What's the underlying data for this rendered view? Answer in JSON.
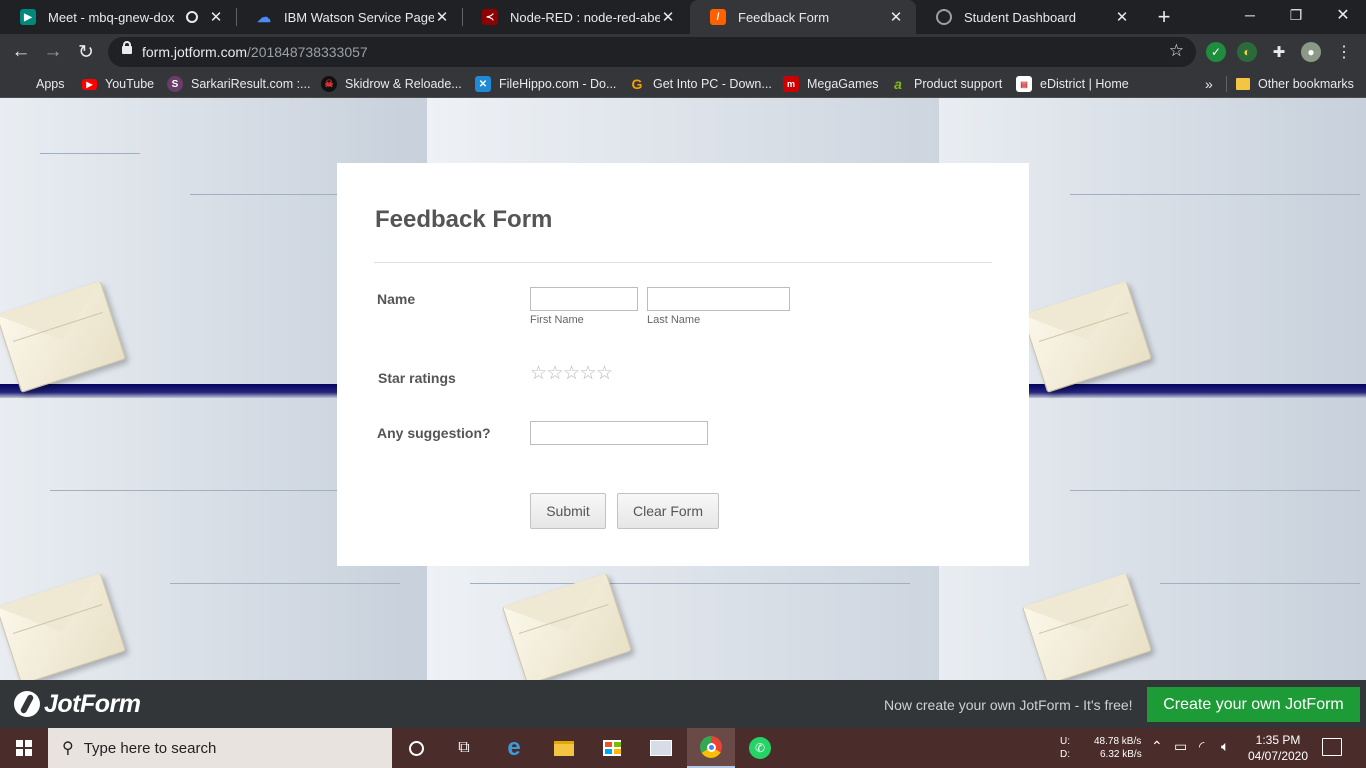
{
  "browser": {
    "tabs": [
      {
        "title": "Meet - mbq-gnew-dox",
        "active": false,
        "favicon": "google-meet-icon",
        "color": "#00897b"
      },
      {
        "title": "IBM Watson Service Page",
        "active": false,
        "favicon": "ibm-cloud-icon",
        "color": "#4a8bf5"
      },
      {
        "title": "Node-RED : node-red-abes.eu",
        "active": false,
        "favicon": "node-red-icon",
        "color": "#8f0000"
      },
      {
        "title": "Feedback Form",
        "active": true,
        "favicon": "jotform-icon",
        "color": "#ff6100"
      },
      {
        "title": "Student Dashboard",
        "active": false,
        "favicon": "globe-icon",
        "color": "#9aa0a6"
      }
    ],
    "url_domain": "form.jotform.com",
    "url_path": "/201848738333057",
    "bookmarks": [
      {
        "label": "Apps",
        "icon": "apps-grid-icon"
      },
      {
        "label": "YouTube",
        "icon": "youtube-icon"
      },
      {
        "label": "SarkariResult.com :...",
        "icon": "sarkari-result-icon"
      },
      {
        "label": "Skidrow & Reloade...",
        "icon": "skidrow-icon"
      },
      {
        "label": "FileHippo.com - Do...",
        "icon": "filehippo-icon"
      },
      {
        "label": "Get Into PC - Down...",
        "icon": "getintopc-icon"
      },
      {
        "label": "MegaGames",
        "icon": "megagames-icon"
      },
      {
        "label": "Product support",
        "icon": "acer-icon"
      },
      {
        "label": "eDistrict | Home",
        "icon": "edistrict-icon"
      }
    ],
    "overflow_label": "»",
    "other_bookmarks": "Other bookmarks"
  },
  "form": {
    "title": "Feedback Form",
    "name_label": "Name",
    "first_name_sublabel": "First Name",
    "last_name_sublabel": "Last Name",
    "first_name_value": "",
    "last_name_value": "",
    "star_label": "Star ratings",
    "star_count": 5,
    "star_glyph": "☆",
    "suggestion_label": "Any suggestion?",
    "suggestion_value": "",
    "submit_label": "Submit",
    "clear_label": "Clear Form"
  },
  "footer": {
    "logo_text": "JotForm",
    "promo_text": "Now create your own JotForm - It's free!",
    "cta_label": "Create your own JotForm",
    "cta_color": "#1c9b37"
  },
  "taskbar": {
    "search_placeholder": "Type here to search",
    "upload_label": "U:",
    "download_label": "D:",
    "upload_speed": "48.78 kB/s",
    "download_speed": "6.32 kB/s",
    "time": "1:35 PM",
    "date": "04/07/2020"
  }
}
